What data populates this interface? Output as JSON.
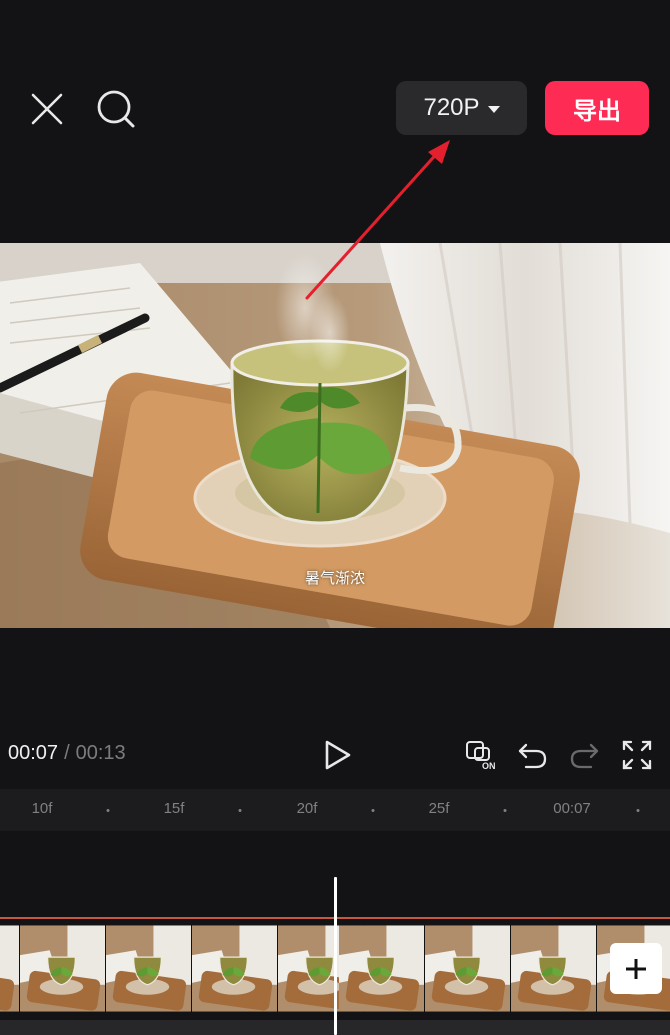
{
  "toolbar": {
    "resolution_label": "720P",
    "export_label": "导出",
    "close_icon": "close-icon",
    "search_icon": "search-icon",
    "accent_color": "#fe2c55"
  },
  "preview": {
    "caption": "暑气渐浓"
  },
  "playback": {
    "current_time": "00:07",
    "separator": "/",
    "total_time": "00:13",
    "play_icon": "play-icon",
    "tools": [
      "smart-on-icon",
      "undo-icon",
      "redo-icon",
      "fullscreen-icon"
    ]
  },
  "ruler": {
    "ticks": [
      "10f",
      "15f",
      "20f",
      "25f",
      "00:07"
    ]
  },
  "timeline": {
    "add_icon": "plus-icon"
  }
}
